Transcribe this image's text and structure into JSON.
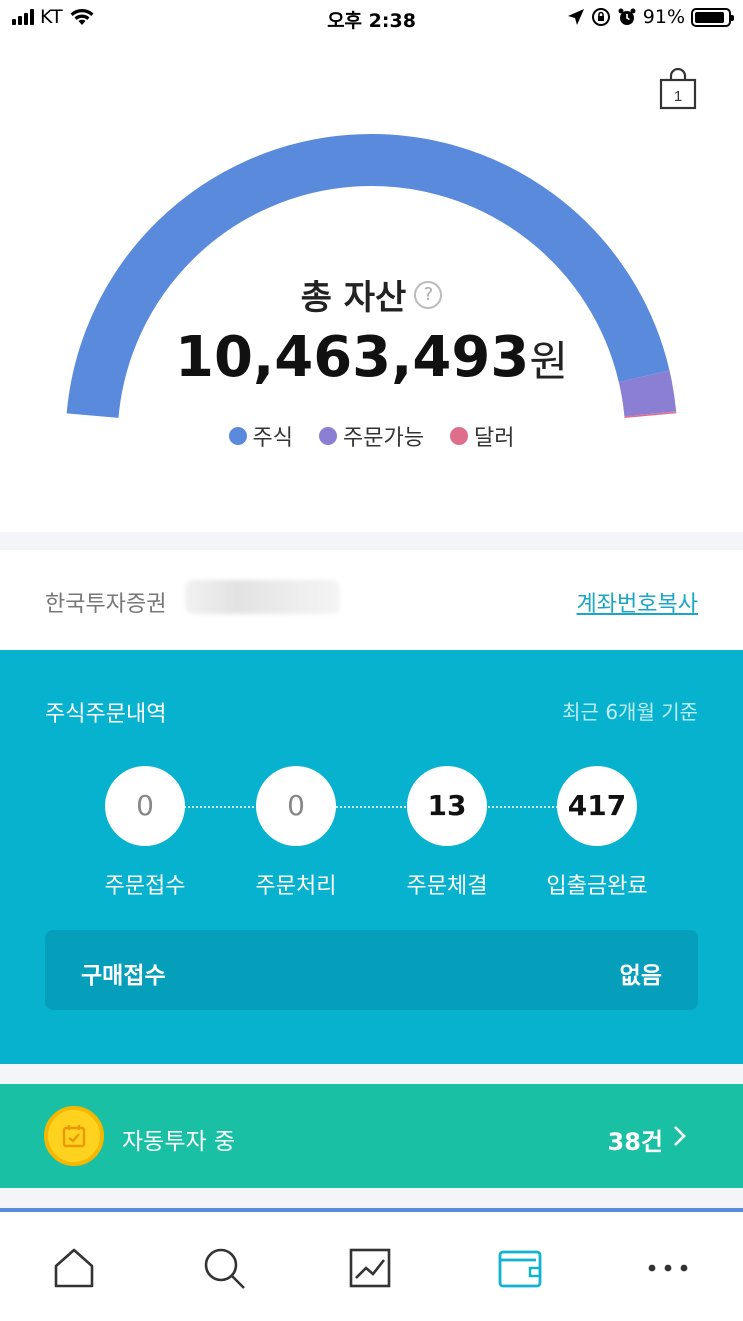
{
  "status_bar": {
    "carrier": "KT",
    "time": "오후 2:38",
    "battery": "91%",
    "battery_level": 0.91
  },
  "cart": {
    "count": "1",
    "icon": "shopping-bag-icon"
  },
  "assets": {
    "title": "총 자산",
    "help_icon": "?",
    "total": "10,463,493",
    "unit": "원",
    "legend": [
      {
        "label": "주식",
        "color": "#5a8adb"
      },
      {
        "label": "주문가능",
        "color": "#8b7fd4"
      },
      {
        "label": "달러",
        "color": "#de6e8c"
      }
    ],
    "gauge_fractions": [
      0.952,
      0.046,
      0.002
    ]
  },
  "account": {
    "broker": "한국투자증권",
    "copy_label": "계좌번호복사"
  },
  "orders": {
    "title": "주식주문내역",
    "period": "최근 6개월 기준",
    "steps": [
      {
        "count": "0",
        "label": "주문접수"
      },
      {
        "count": "0",
        "label": "주문처리"
      },
      {
        "count": "13",
        "label": "주문체결"
      },
      {
        "count": "417",
        "label": "입출금완료"
      }
    ],
    "purchase": {
      "label": "구매접수",
      "value": "없음"
    }
  },
  "auto_invest": {
    "label": "자동투자 중",
    "count": "38건"
  },
  "tabbar": {
    "tabs": [
      "home-icon",
      "search-icon",
      "chart-icon",
      "wallet-icon",
      "more-icon"
    ],
    "active_color": "#0fb3cf"
  }
}
